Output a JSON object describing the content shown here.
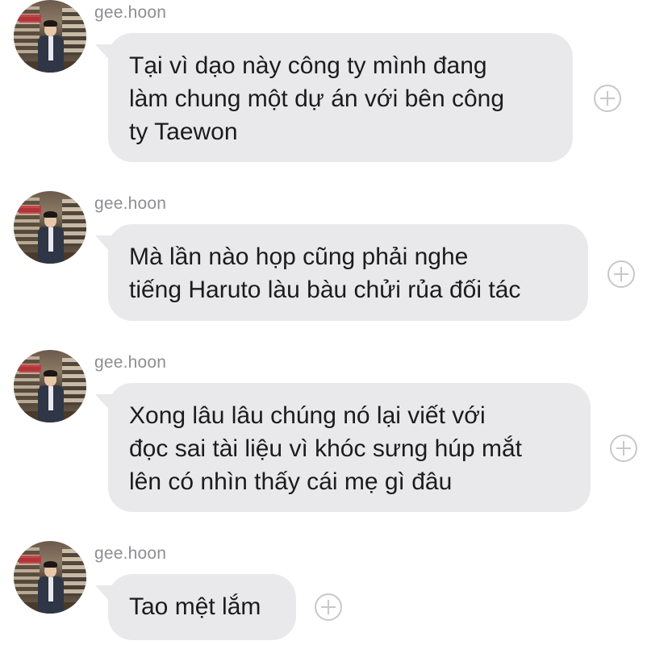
{
  "messages": [
    {
      "sender": "gee.hoon",
      "text": "Tại vì dạo này công ty mình đang\nlàm chung một dự án với bên công\nty Taewon"
    },
    {
      "sender": "gee.hoon",
      "text": "Mà lần nào họp cũng phải nghe\ntiếng Haruto làu bàu chửi rủa đối tác"
    },
    {
      "sender": "gee.hoon",
      "text": "Xong lâu lâu chúng nó lại viết với\nđọc sai tài liệu vì khóc sưng húp mắt\nlên có nhìn thấy cái mẹ gì đâu"
    },
    {
      "sender": "gee.hoon",
      "text": "Tao mệt lắm"
    }
  ],
  "colors": {
    "bubble_bg": "#e9e9eb",
    "sender_text": "#8e8e93",
    "message_text": "#1c1c1e",
    "add_icon": "#c8c8cc"
  },
  "icons": {
    "add": "plus-circle-icon"
  }
}
